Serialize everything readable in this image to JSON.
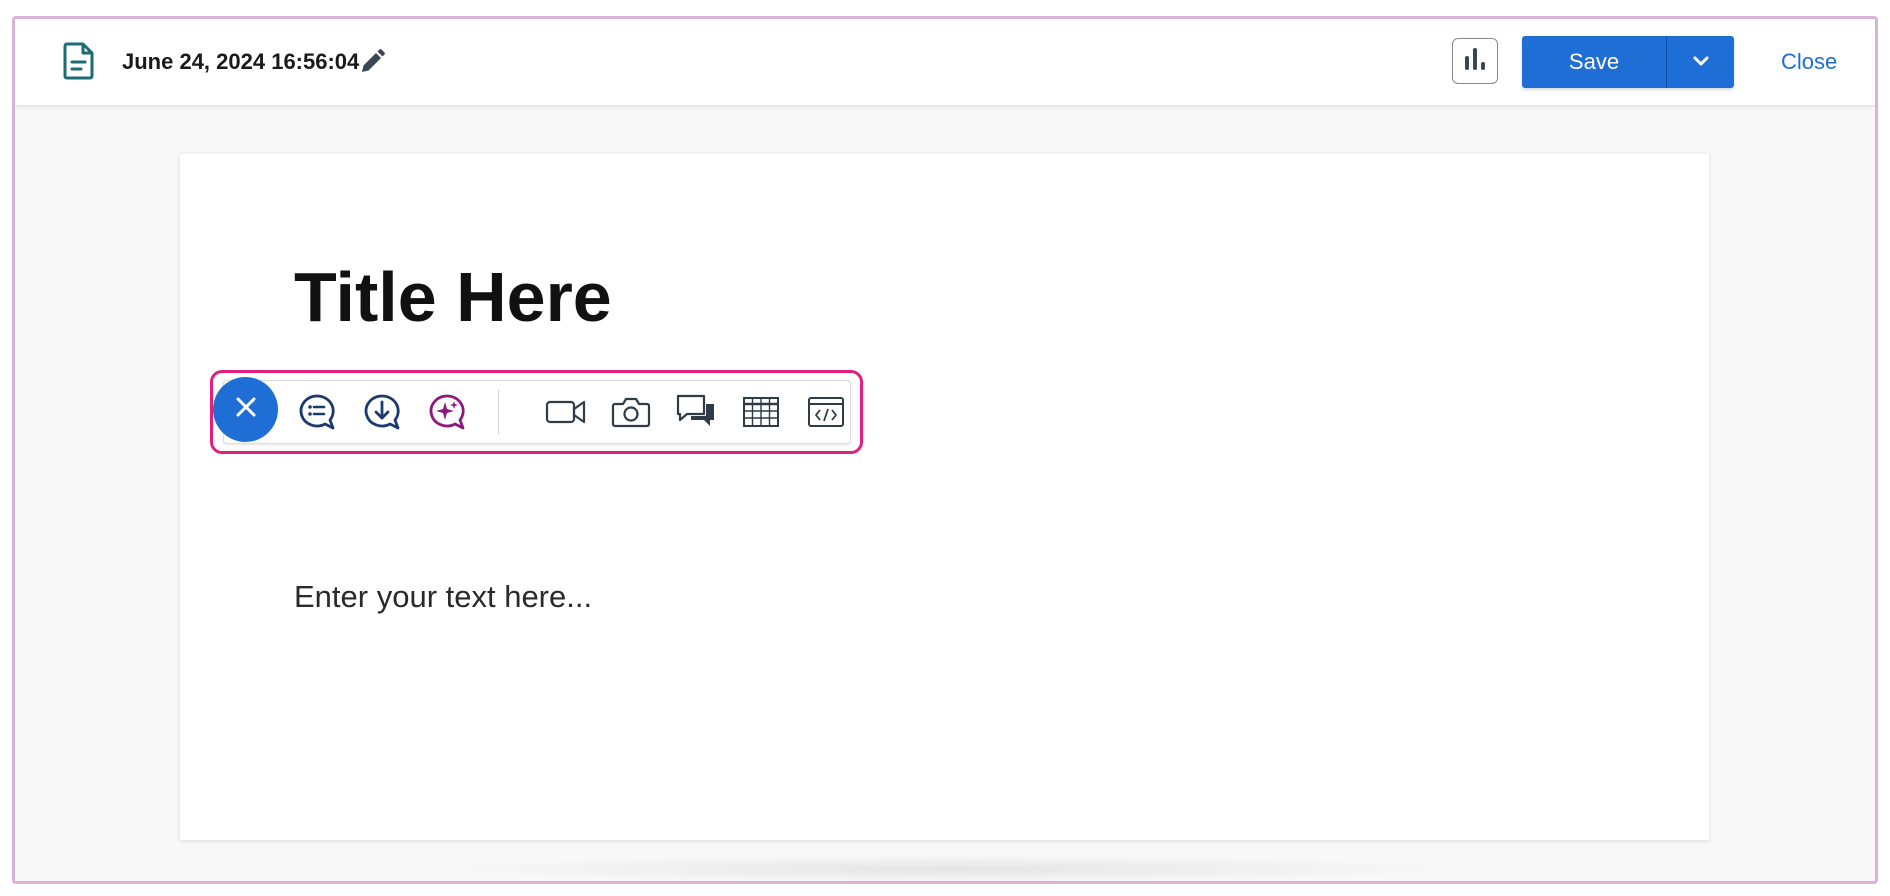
{
  "header": {
    "doc_title": "June 24, 2024 16:56:04",
    "save_label": "Save",
    "close_label": "Close"
  },
  "editor": {
    "title": "Title Here",
    "body_placeholder": "Enter your text here..."
  },
  "toolbar": {
    "items": [
      {
        "name": "close-toolbar",
        "icon": "x-icon"
      },
      {
        "name": "insert-list",
        "icon": "speech-list-icon"
      },
      {
        "name": "insert-download",
        "icon": "speech-download-icon"
      },
      {
        "name": "ai-assist",
        "icon": "speech-sparkle-icon"
      },
      {
        "name": "insert-video",
        "icon": "video-camera-icon"
      },
      {
        "name": "insert-image",
        "icon": "camera-icon"
      },
      {
        "name": "insert-quote",
        "icon": "chat-bubbles-icon"
      },
      {
        "name": "insert-table",
        "icon": "table-icon"
      },
      {
        "name": "insert-embed",
        "icon": "code-window-icon"
      }
    ]
  },
  "colors": {
    "primary": "#1f6ed6",
    "highlight": "#e0207c",
    "ai_accent": "#8a1a7e",
    "icon_navy": "#1c3a6e",
    "doc_icon": "#1d6b73"
  }
}
